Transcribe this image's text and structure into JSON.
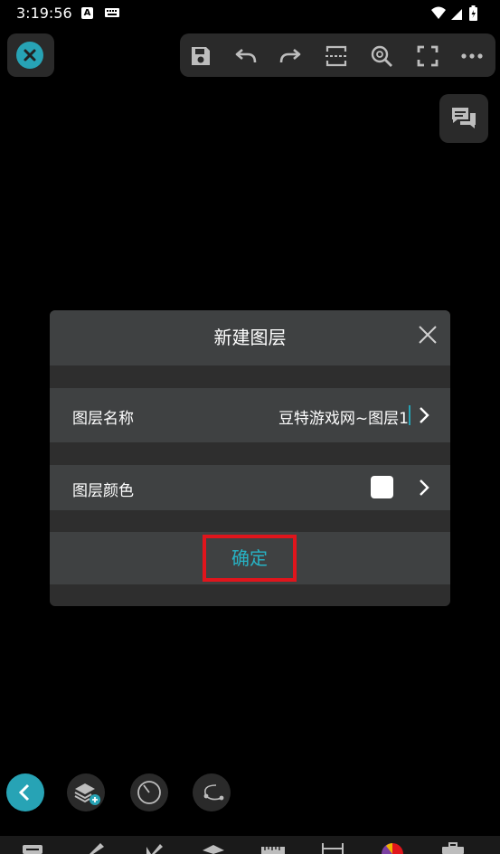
{
  "status_bar": {
    "time": "3:19:56",
    "notif_letter": "A"
  },
  "toolbar": {
    "icons": [
      "save-icon",
      "undo-icon",
      "redo-icon",
      "select-area-icon",
      "zoom-icon",
      "fullscreen-icon",
      "more-icon"
    ]
  },
  "dialog": {
    "title": "新建图层",
    "layer_name_label": "图层名称",
    "layer_name_value": "豆特游戏网~图层1",
    "layer_color_label": "图层颜色",
    "layer_color": "#ffffff",
    "confirm_label": "确定"
  },
  "colors": {
    "accent": "#27a3b5",
    "highlight": "#e0151c",
    "panel": "#3f4142"
  }
}
